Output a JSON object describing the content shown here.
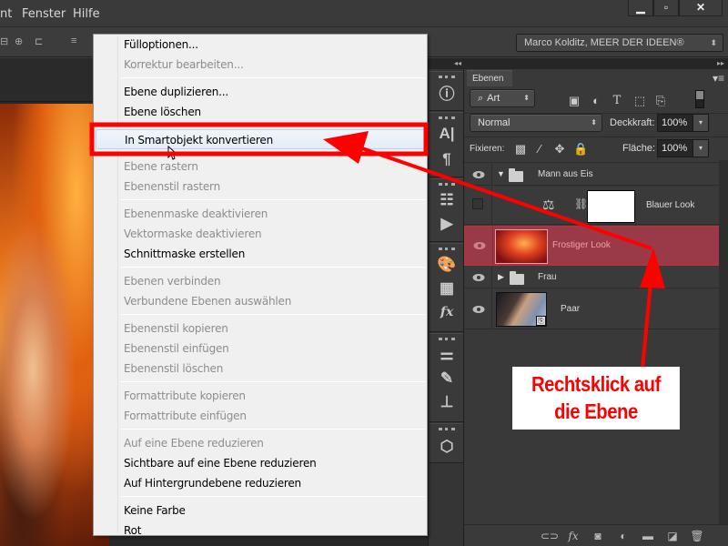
{
  "menubar": {
    "items": [
      "nt",
      "Fenster",
      "Hilfe"
    ],
    "window_controls": {
      "minimize": "minimize-icon",
      "maximize": "maximize-icon",
      "close": "close-icon"
    }
  },
  "options_bar": {
    "align_icons": [
      "align-center-horizontal-icon",
      "align-vertical-centers-icon",
      "align-right-edges-icon",
      "distribute-top-icon"
    ],
    "workspace": "Marco Kolditz, MEER DER IDEEN®"
  },
  "context_menu": {
    "items": [
      {
        "label": "Fülloptionen...",
        "enabled": true
      },
      {
        "label": "Korrektur bearbeiten...",
        "enabled": false
      },
      {
        "separator": true
      },
      {
        "label": "Ebene duplizieren...",
        "enabled": true
      },
      {
        "label": "Ebene löschen",
        "enabled": true
      },
      {
        "separator": true
      },
      {
        "label": "In Smartobjekt konvertieren",
        "enabled": true,
        "highlighted": true
      },
      {
        "separator": true
      },
      {
        "label": "Ebene rastern",
        "enabled": false
      },
      {
        "label": "Ebenenstil rastern",
        "enabled": false
      },
      {
        "separator": true
      },
      {
        "label": "Ebenenmaske deaktivieren",
        "enabled": false
      },
      {
        "label": "Vektormaske deaktivieren",
        "enabled": false
      },
      {
        "label": "Schnittmaske erstellen",
        "enabled": true
      },
      {
        "separator": true
      },
      {
        "label": "Ebenen verbinden",
        "enabled": false
      },
      {
        "label": "Verbundene Ebenen auswählen",
        "enabled": false
      },
      {
        "separator": true
      },
      {
        "label": "Ebenenstil kopieren",
        "enabled": false
      },
      {
        "label": "Ebenenstil einfügen",
        "enabled": false
      },
      {
        "label": "Ebenenstil löschen",
        "enabled": false
      },
      {
        "separator": true
      },
      {
        "label": "Formattribute kopieren",
        "enabled": false
      },
      {
        "label": "Formattribute einfügen",
        "enabled": false
      },
      {
        "separator": true
      },
      {
        "label": "Auf eine Ebene reduzieren",
        "enabled": false
      },
      {
        "label": "Sichtbare auf eine Ebene reduzieren",
        "enabled": true
      },
      {
        "label": "Auf Hintergrundebene reduzieren",
        "enabled": true
      },
      {
        "separator": true
      },
      {
        "label": "Keine Farbe",
        "enabled": true
      },
      {
        "label": "Rot",
        "enabled": true
      }
    ]
  },
  "dock": {
    "collapse_label": "◂◂",
    "icons": [
      "info-icon",
      "character-icon",
      "paragraph-icon",
      "history-icon",
      "actions-icon",
      "color-palette-icon",
      "swatches-icon",
      "styles-icon",
      "adjustments-icon",
      "brushes-icon",
      "clone-source-icon",
      "3d-icon"
    ]
  },
  "layers_panel": {
    "expand_label": "▸▸",
    "tab": "Ebenen",
    "filter": {
      "label": "Art",
      "icons": [
        "pixel-filter-icon",
        "adjustment-filter-icon",
        "type-filter-icon",
        "shape-filter-icon",
        "smartobject-filter-icon"
      ]
    },
    "blend_mode": "Normal",
    "opacity_label": "Deckkraft:",
    "opacity": "100%",
    "lock_label": "Fixieren:",
    "fill_label": "Fläche:",
    "fill": "100%",
    "layers": [
      {
        "name": "Mann aus Eis",
        "type": "group",
        "expanded": true,
        "visible": true
      },
      {
        "name": "Blauer Look",
        "type": "adjustment",
        "visible": false
      },
      {
        "name": "Frostiger Look",
        "type": "smart",
        "visible": true,
        "selected": true
      },
      {
        "name": "Frau",
        "type": "group",
        "expanded": false,
        "visible": true
      },
      {
        "name": "Paar",
        "type": "smart",
        "visible": true
      }
    ],
    "footer_icons": [
      "link-layers-icon",
      "fx-icon",
      "add-mask-icon",
      "new-adjustment-icon",
      "new-group-icon",
      "new-layer-icon",
      "trash-icon"
    ]
  },
  "annotation": {
    "callout_line1": "Rechtsklick auf",
    "callout_line2": "die Ebene",
    "color": "#ff0000"
  }
}
